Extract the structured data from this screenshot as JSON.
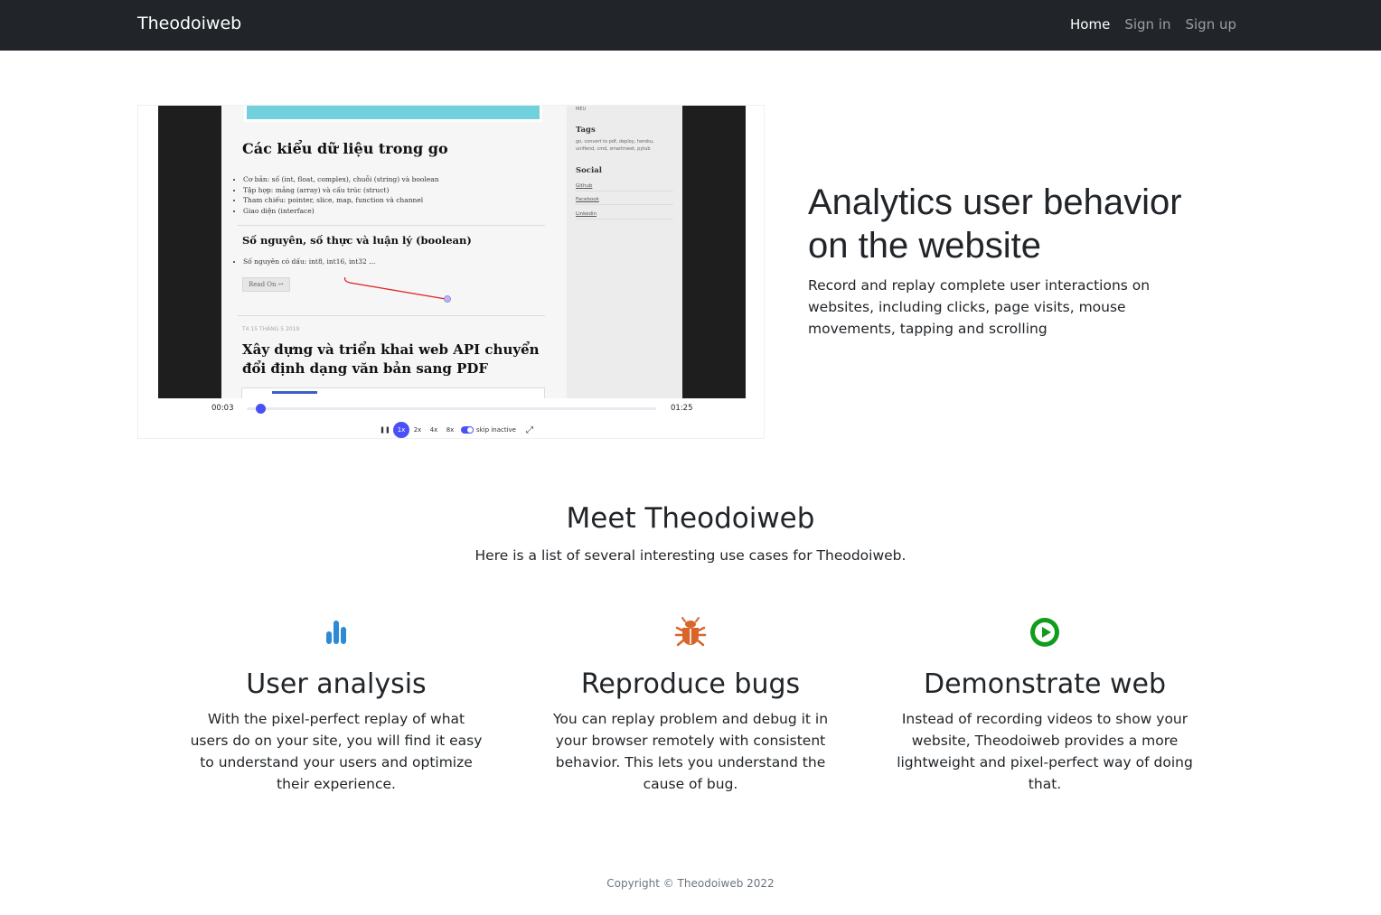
{
  "navbar": {
    "brand": "Theodoiweb",
    "links": [
      {
        "label": "Home",
        "active": true
      },
      {
        "label": "Sign in",
        "active": false
      },
      {
        "label": "Sign up",
        "active": false
      }
    ]
  },
  "hero": {
    "title": "Analytics user behavior on the website",
    "lead": "Record and replay complete user interactions on websites, including clicks, page visits, mouse movements, tapping and scrolling",
    "player": {
      "recorded_page": {
        "post1_title": "Các kiểu dữ liệu trong go",
        "post1_bullets": [
          "Cơ bản: số (int, float, complex), chuỗi (string) và boolean",
          "Tập hợp: mảng (array) và cấu trúc (struct)",
          "Tham chiếu: pointer, slice, map, function và channel",
          "Giao diện (interface)"
        ],
        "post2_title": "Số nguyên, số thực và luận lý (boolean)",
        "post2_bullets": [
          "Số nguyên có dấu: int8, int16, int32 ..."
        ],
        "read_on": "Read On ↩",
        "post3_date": "T4 15 THÁNG 5 2019",
        "post3_title": "Xây dựng và triển khai web API chuyển đổi định dạng văn bản sang PDF",
        "sidebar_top": "MEU",
        "tags_heading": "Tags",
        "tags_text": "go, convert to pdf, deploy, heroku, unifiend, cmd, smartmeet, pytub",
        "social_heading": "Social",
        "social_links": [
          "Github",
          "Facebook",
          "Linkedin"
        ]
      },
      "current_time": "00:03",
      "total_time": "01:25",
      "progress_fraction": 0.035,
      "speeds": [
        "1x",
        "2x",
        "4x",
        "8x"
      ],
      "active_speed": "1x",
      "skip_inactive_label": "skip inactive",
      "skip_inactive_on": true,
      "accent_color": "#4950f6"
    }
  },
  "meet": {
    "title": "Meet Theodoiweb",
    "subtitle": "Here is a list of several interesting use cases for Theodoiweb."
  },
  "features": [
    {
      "icon": "bar-chart-icon",
      "color": "#2d8bd6",
      "title": "User analysis",
      "text": "With the pixel-perfect replay of what users do on your site, you will find it easy to understand your users and optimize their experience."
    },
    {
      "icon": "bug-icon",
      "color": "#d9652b",
      "title": "Reproduce bugs",
      "text": "You can replay problem and debug it in your browser remotely with consistent behavior. This lets you understand the cause of bug."
    },
    {
      "icon": "play-circle-icon",
      "color": "#119c1c",
      "title": "Demonstrate web",
      "text": "Instead of recording videos to show your website, Theodoiweb provides a more lightweight and pixel-perfect way of doing that."
    }
  ],
  "footer": {
    "text": "Copyright © Theodoiweb 2022"
  }
}
